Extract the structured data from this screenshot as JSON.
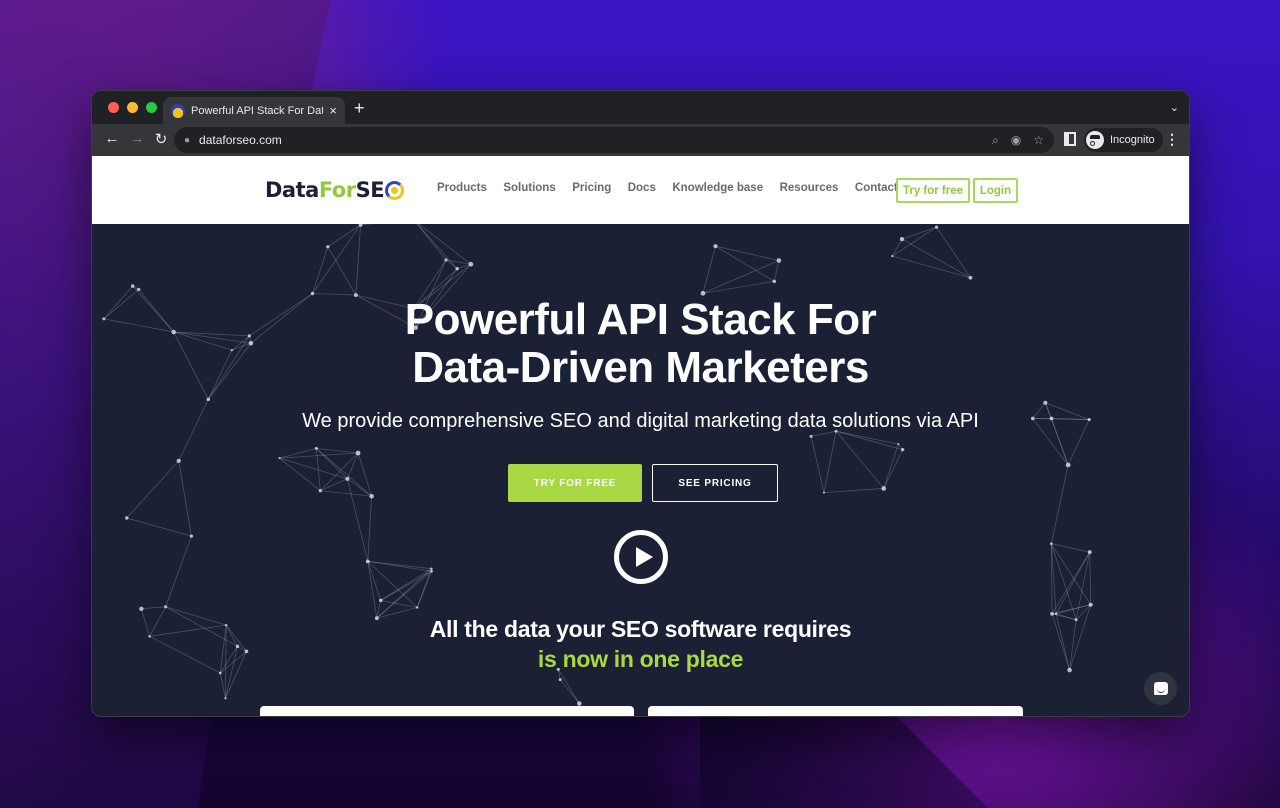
{
  "browser": {
    "tab": {
      "title": "Powerful API Stack For Data-D",
      "favicon": "dataforseo-favicon",
      "close_icon": "×"
    },
    "new_tab_icon": "+",
    "tab_list_icon": "⌄",
    "nav": {
      "back_icon": "←",
      "forward_icon": "→",
      "reload_icon": "↻"
    },
    "omnibox": {
      "url": "dataforseo.com",
      "lock_icon": "🔒",
      "zoom_icon": "⌕",
      "eye_off_icon": "◉",
      "star_icon": "☆"
    },
    "profile_label": "Incognito",
    "menu_icon": "⋮"
  },
  "site": {
    "logo": {
      "part1": "Data",
      "part2": "For",
      "part3": "SE"
    },
    "nav": [
      {
        "label": "Products"
      },
      {
        "label": "Solutions"
      },
      {
        "label": "Pricing"
      },
      {
        "label": "Docs"
      },
      {
        "label": "Knowledge base"
      },
      {
        "label": "Resources"
      },
      {
        "label": "Contact"
      }
    ],
    "try_free_label": "Try for free",
    "login_label": "Login",
    "colors": {
      "accent": "#a8d843",
      "dark": "#1b2035",
      "brand_blue": "#2a47c9",
      "brand_yellow": "#f0c419"
    }
  },
  "hero": {
    "title_line1": "Powerful API Stack For",
    "title_line2": "Data-Driven Marketers",
    "subtitle": "We provide comprehensive SEO and digital marketing data solutions via API",
    "cta_primary": "TRY FOR FREE",
    "cta_secondary": "SEE PRICING",
    "tagline": "All the data your SEO software requires",
    "tagline_accent": "is now in one place"
  }
}
